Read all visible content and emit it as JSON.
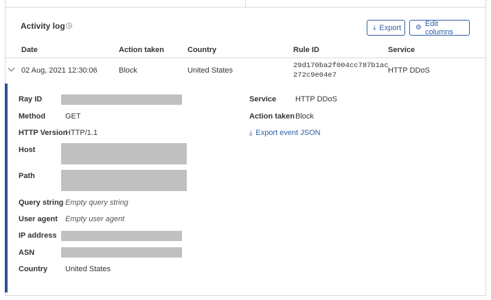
{
  "header": {
    "title": "Activity log",
    "clock_icon": "clock-icon",
    "export_label": "Export",
    "edit_columns_label": "Edit columns"
  },
  "table": {
    "columns": [
      "Date",
      "Action taken",
      "Country",
      "Rule ID",
      "Service"
    ],
    "row": {
      "date": "02 Aug, 2021 12:30:06",
      "action": "Block",
      "country": "United States",
      "rule_id_line1": "29d170ba2f004cc787b1ac",
      "rule_id_line2": "272c9e04e7",
      "service": "HTTP DDoS"
    }
  },
  "details": {
    "left": [
      {
        "label": "Ray ID",
        "value": "",
        "redacted": true
      },
      {
        "label": "Method",
        "value": "GET"
      },
      {
        "label": "HTTP Version",
        "value": "HTTP/1.1"
      },
      {
        "label": "Host",
        "value": "",
        "redacted": true
      },
      {
        "label": "Path",
        "value": "",
        "redacted": true
      },
      {
        "label": "Query string",
        "value": "Empty query string"
      },
      {
        "label": "User agent",
        "value": "Empty user agent"
      },
      {
        "label": "IP address",
        "value": "",
        "redacted": true
      },
      {
        "label": "ASN",
        "value": "",
        "redacted": true
      },
      {
        "label": "Country",
        "value": "United States"
      }
    ],
    "right": [
      {
        "label": "Service",
        "value": "HTTP DDoS"
      },
      {
        "label": "Action taken",
        "value": "Block"
      }
    ],
    "export_json_label": "Export event JSON"
  },
  "colors": {
    "accent": "#2f4f8f",
    "link": "#2f5ea7",
    "redaction": "#c0c0c0"
  }
}
